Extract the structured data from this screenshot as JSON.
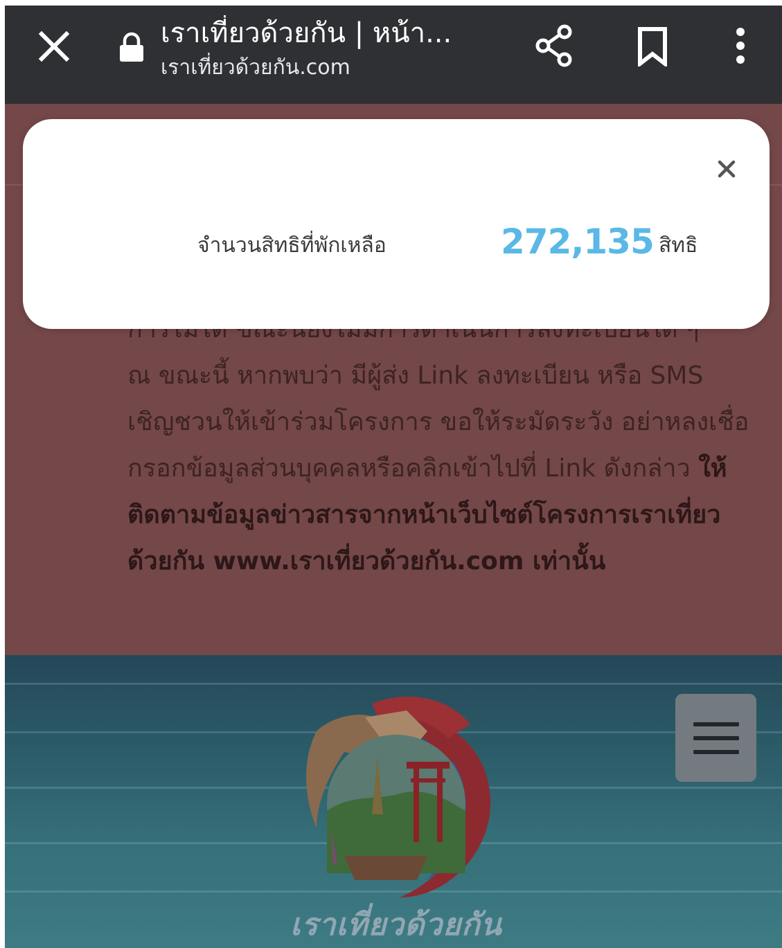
{
  "browser": {
    "page_title": "เราเที่ยวด้วยกัน | หน้า...",
    "url": "เราเที่ยวด้วยกัน.com",
    "icons": {
      "close": "close-icon",
      "lock": "lock-icon",
      "share": "share-icon",
      "bookmark": "bookmark-icon",
      "more": "more-vert-icon"
    }
  },
  "modal": {
    "label": "จำนวนสิทธิที่พักเหลือ",
    "count": "272,135",
    "unit": "สิทธิ",
    "count_color": "#5ab8e6",
    "close_icon": "close-icon"
  },
  "notice": {
    "partial_line": "การไม่ได้ ขณะนี้ยังไม่มีการดำเนินการลงทะเบียนใด ๆ",
    "text": "ณ ขณะนี้ หากพบว่า มีผู้ส่ง Link ลงทะเบียน หรือ SMS เชิญชวนให้เข้าร่วมโครงการ ขอให้ระมัดระวัง อย่าหลงเชื่อกรอกข้อมูลส่วนบุคคลหรือคลิกเข้าไปที่ Link ดังกล่าว",
    "bold_text": "ให้ติดตามข้อมูลข่าวสารจากหน้าเว็บไซต์โครงการเราเที่ยวด้วยกัน www.เราเที่ยวด้วยกัน.com เท่านั้น"
  },
  "hero": {
    "brand_text": "เราเที่ยวด้วยกัน",
    "menu_icon": "hamburger-menu-icon"
  },
  "colors": {
    "toolbar": "#2f3034",
    "overlay": "#744748",
    "modal_bg": "#ffffff",
    "accent": "#5ab8e6"
  }
}
